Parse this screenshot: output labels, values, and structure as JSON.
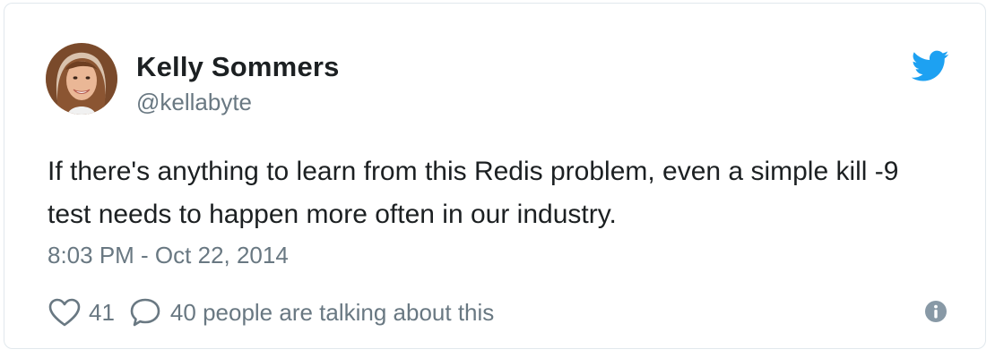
{
  "author": {
    "name": "Kelly Sommers",
    "handle": "@kellabyte",
    "avatar_icon": "profile-photo"
  },
  "brand_icon": "twitter-bird-icon",
  "tweet": {
    "text": "If there's anything to learn from this Redis problem, even a simple kill -9 test needs to happen more often in our industry.",
    "timestamp": "8:03 PM - Oct 22, 2014"
  },
  "actions": {
    "like_count": "41",
    "reply_text": "40 people are talking about this",
    "like_icon": "heart-icon",
    "reply_icon": "speech-bubble-icon",
    "info_icon": "info-icon"
  },
  "colors": {
    "brand": "#1da1f2",
    "text": "#1c2022",
    "muted": "#697882",
    "border": "#e1e8ed"
  }
}
